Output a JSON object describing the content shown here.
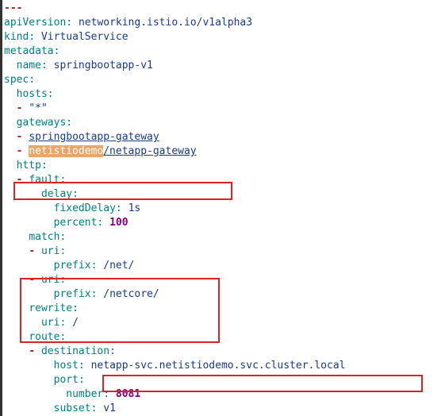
{
  "yaml": {
    "apiVersion_key": "apiVersion",
    "apiVersion_val": "networking.istio.io/v1alpha3",
    "kind_key": "kind",
    "kind_val": "VirtualService",
    "metadata_key": "metadata",
    "name_key": "name",
    "name_val": "springbootapp-v1",
    "spec_key": "spec",
    "hosts_key": "hosts",
    "hosts_val": "\"*\"",
    "gateways_key": "gateways",
    "gateway1": "springbootapp-gateway",
    "gateway2_ns": "netistiodemo",
    "gateway2_name": "/netapp-gateway",
    "http_key": "http",
    "fault_key": "fault",
    "delay_key": "delay",
    "fixedDelay_key": "fixedDelay",
    "fixedDelay_val": "1s",
    "percent_key": "percent",
    "percent_val": "100",
    "match_key": "match",
    "uri_key": "uri",
    "prefix_key": "prefix",
    "prefix1_val": "/net/",
    "prefix2_val": "/netcore/",
    "rewrite_key": "rewrite",
    "rewrite_uri_val": "/",
    "route_key": "route",
    "destination_key": "destination",
    "host_key": "host",
    "host_val": "netapp-svc.netistiodemo.svc.cluster.local",
    "port_key": "port",
    "number_key": "number",
    "number_val": "8081",
    "subset_key": "subset",
    "subset_val": "v1",
    "dashes": "---"
  }
}
